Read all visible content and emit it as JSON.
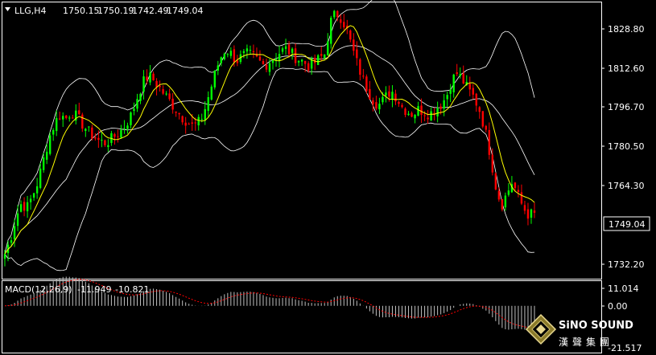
{
  "header": {
    "symbol": "LLG,H4",
    "open": "1750.15",
    "high": "1750.19",
    "low": "1742.49",
    "close": "1749.04"
  },
  "macd": {
    "label": "MACD(12,26,9)",
    "main": "-11.949",
    "signal": "-10.821",
    "axis_labels": [
      "11.014",
      "0.00",
      "-21.517"
    ],
    "axis_values": [
      11.014,
      0.0,
      -21.517
    ]
  },
  "price_axis": {
    "labels": [
      "1828.80",
      "1812.60",
      "1796.70",
      "1780.50",
      "1764.30",
      "1732.20"
    ],
    "current_price": "1749.04",
    "current_value": 1749.04
  },
  "logo": {
    "text_en": "SiNO SOUND",
    "text_cn": "漢聲集團"
  },
  "colors": {
    "background": "#000000",
    "bull_candle": "#00ff00",
    "bear_candle": "#ff0000",
    "bollinger": "#ffffff",
    "ma": "#ffff00",
    "macd_hist": "#c0c0c0",
    "macd_signal": "#ff0000"
  },
  "chart_data": {
    "type": "candlestick",
    "ylim": [
      1722,
      1836
    ],
    "grid": false,
    "close_path": [
      1732,
      1738,
      1747,
      1753,
      1751,
      1756,
      1762,
      1771,
      1780,
      1786,
      1790,
      1788,
      1791,
      1789,
      1786,
      1783,
      1781,
      1779,
      1778,
      1779,
      1781,
      1783,
      1786,
      1790,
      1797,
      1803,
      1806,
      1804,
      1801,
      1798,
      1795,
      1792,
      1789,
      1787,
      1785,
      1786,
      1790,
      1798,
      1806,
      1813,
      1817,
      1815,
      1812,
      1814,
      1815,
      1814,
      1812,
      1810,
      1812,
      1814,
      1816,
      1817,
      1815,
      1813,
      1812,
      1810,
      1811,
      1813,
      1815,
      1828,
      1832,
      1830,
      1825,
      1817,
      1810,
      1804,
      1799,
      1795,
      1794,
      1797,
      1800,
      1797,
      1793,
      1791,
      1790,
      1792,
      1791,
      1790,
      1792,
      1794,
      1797,
      1804,
      1807,
      1804,
      1800,
      1797,
      1792,
      1784,
      1773,
      1760,
      1752,
      1757,
      1762,
      1756,
      1751,
      1748,
      1749.04
    ]
  }
}
